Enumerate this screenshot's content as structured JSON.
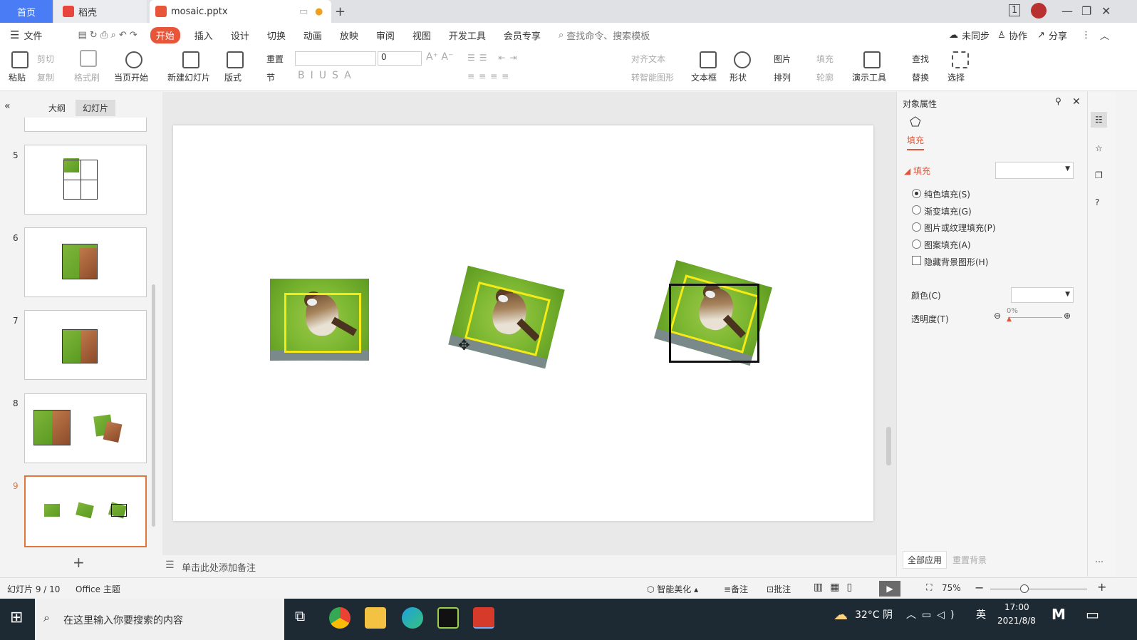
{
  "titlebar": {
    "tab_home": "首页",
    "tab_daoke": "稻壳",
    "tab_doc": "mosaic.pptx"
  },
  "menubar": {
    "file": "文件",
    "items": [
      "开始",
      "插入",
      "设计",
      "切换",
      "动画",
      "放映",
      "审阅",
      "视图",
      "开发工具",
      "会员专享"
    ],
    "search": "查找命令、搜索模板",
    "unsynced": "未同步",
    "collab": "协作",
    "share": "分享"
  },
  "ribbon": {
    "paste": "粘贴",
    "cut": "剪切",
    "copy": "复制",
    "format_painter": "格式刷",
    "from_current": "当页开始",
    "new_slide": "新建幻灯片",
    "layout": "版式",
    "reset": "重置",
    "section": "节",
    "font_size": "0",
    "align_text": "对齐文本",
    "smart_shape": "转智能图形",
    "textbox": "文本框",
    "shape": "形状",
    "picture": "图片",
    "arrange": "排列",
    "fill": "填充",
    "outline": "轮廓",
    "present_tools": "演示工具",
    "find": "查找",
    "replace": "替换",
    "select": "选择"
  },
  "leftpanel": {
    "tab_outline": "大纲",
    "tab_slides": "幻灯片",
    "slides": [
      "5",
      "6",
      "7",
      "8",
      "9"
    ]
  },
  "notes": {
    "placeholder": "单击此处添加备注"
  },
  "rightpanel": {
    "title": "对象属性",
    "fill_tab": "填充",
    "section": "填充",
    "options": [
      "纯色填充(S)",
      "渐变填充(G)",
      "图片或纹理填充(P)",
      "图案填充(A)"
    ],
    "hide_bg": "隐藏背景图形(H)",
    "color_label": "颜色(C)",
    "transparency_label": "透明度(T)",
    "transparency_value": "0%",
    "apply_all": "全部应用",
    "reset_bg": "重置背景"
  },
  "statusbar": {
    "slide_info": "幻灯片 9 / 10",
    "theme": "Office 主题",
    "beautify": "智能美化",
    "notes": "备注",
    "comments": "批注",
    "zoom": "75%"
  },
  "taskbar": {
    "search_placeholder": "在这里输入你要搜索的内容",
    "weather": "32°C 阴",
    "lang": "英",
    "time": "17:00",
    "date": "2021/8/8"
  },
  "colors": {
    "accent_blue": "#4a7cf6",
    "accent_orange": "#e8563a",
    "selected_thumb": "#e0763a",
    "yellow_frame": "#f5ea16"
  }
}
